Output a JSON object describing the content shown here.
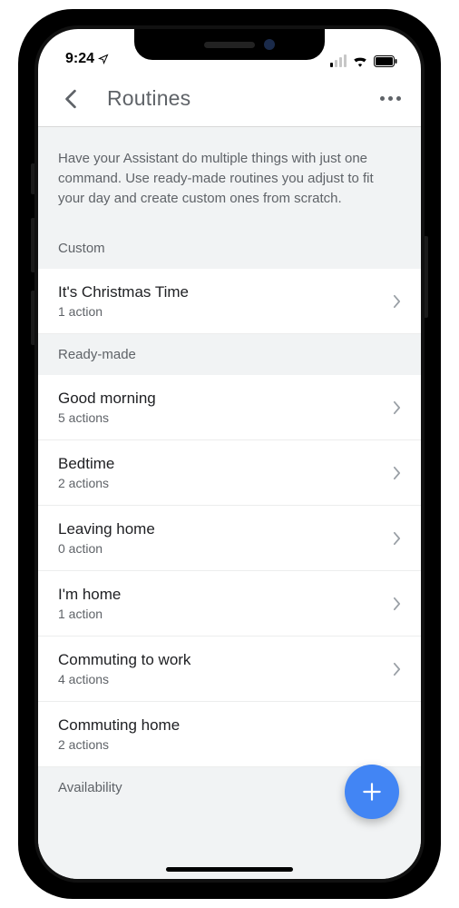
{
  "status": {
    "time": "9:24",
    "location_arrow": "↗",
    "signal_bars": 4,
    "signal_active": 1
  },
  "header": {
    "title": "Routines"
  },
  "intro": "Have your Assistant do multiple things with just one command. Use ready-made routines you adjust to fit your day and create custom ones from scratch.",
  "sections": {
    "custom": {
      "label": "Custom",
      "items": [
        {
          "name": "It's Christmas Time",
          "sub": "1 action"
        }
      ]
    },
    "ready": {
      "label": "Ready-made",
      "items": [
        {
          "name": "Good morning",
          "sub": "5 actions"
        },
        {
          "name": "Bedtime",
          "sub": "2 actions"
        },
        {
          "name": "Leaving home",
          "sub": "0 action"
        },
        {
          "name": "I'm home",
          "sub": "1 action"
        },
        {
          "name": "Commuting to work",
          "sub": "4 actions"
        },
        {
          "name": "Commuting home",
          "sub": "2 actions"
        }
      ]
    }
  },
  "availability_label": "Availability",
  "colors": {
    "accent": "#4285f4",
    "text_primary": "#202124",
    "text_secondary": "#5f6368",
    "bg_grey": "#f1f3f4"
  }
}
